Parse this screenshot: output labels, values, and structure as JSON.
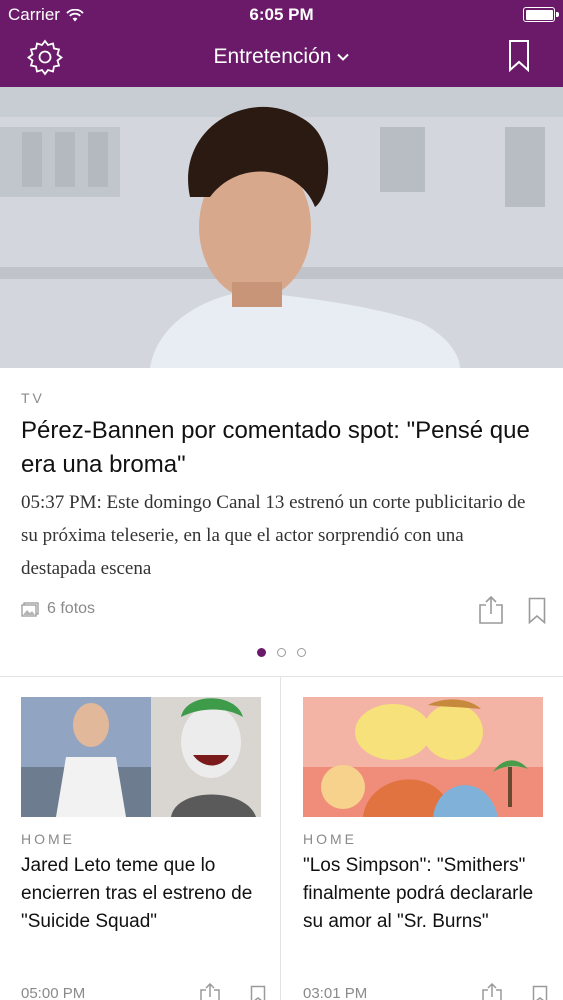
{
  "status_bar": {
    "carrier": "Carrier",
    "time": "6:05 PM"
  },
  "nav": {
    "title": "Entretención"
  },
  "hero": {
    "section": "TV",
    "title": "Pérez-Bannen por comentado spot: \"Pensé que era una broma\"",
    "description": "05:37 PM: Este domingo Canal 13 estrenó un corte publicitario de su próxima teleserie, en la que el actor sorprendió con una destapada escena",
    "photos_label": "6 fotos"
  },
  "pager": {
    "pages": 3,
    "active": 0
  },
  "cards": [
    {
      "section": "HOME",
      "title": "Jared Leto teme que lo encierren tras el estreno de \"Suicide Squad\"",
      "time": "05:00 PM"
    },
    {
      "section": "HOME",
      "title": "\"Los Simpson\": \"Smithers\" finalmente podrá declararle su amor al \"Sr. Burns\"",
      "time": "03:01 PM"
    }
  ],
  "colors": {
    "brand": "#6b1a6a",
    "muted": "#8a8a8a"
  },
  "icons": [
    "wifi-icon",
    "battery-icon",
    "gear-icon",
    "chevron-down-icon",
    "bookmark-icon",
    "photos-icon",
    "share-icon"
  ]
}
